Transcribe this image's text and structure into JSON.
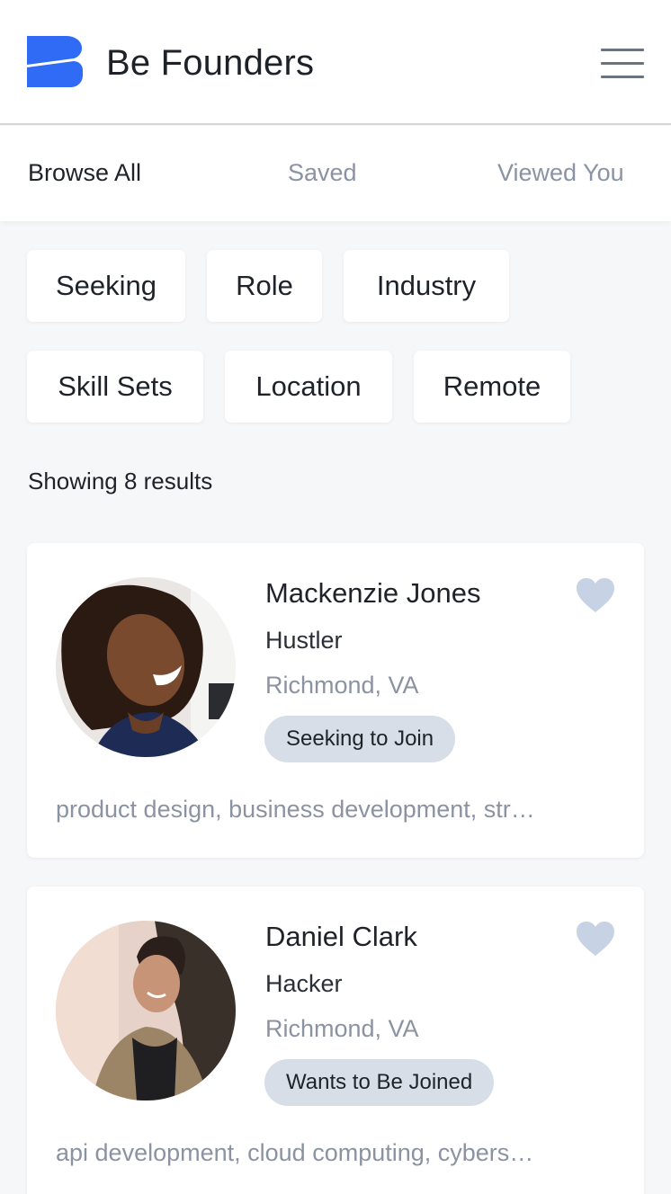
{
  "header": {
    "brand": "Be Founders",
    "logo_color": "#2f6bf5",
    "menu_icon": "hamburger-menu-icon"
  },
  "tabs": [
    {
      "label": "Browse All",
      "active": true
    },
    {
      "label": "Saved",
      "active": false
    },
    {
      "label": "Viewed You",
      "active": false
    }
  ],
  "filters": {
    "row1": [
      "Seeking",
      "Role",
      "Industry"
    ],
    "row2": [
      "Skill Sets",
      "Location",
      "Remote"
    ]
  },
  "results_text": "Showing 8 results",
  "profiles": [
    {
      "name": "Mackenzie Jones",
      "role": "Hustler",
      "location": "Richmond, VA",
      "status": "Seeking to Join",
      "skills": "product design, business development, str…"
    },
    {
      "name": "Daniel Clark",
      "role": "Hacker",
      "location": "Richmond, VA",
      "status": "Wants to Be Joined",
      "skills": "api development, cloud computing, cybers…"
    }
  ],
  "colors": {
    "accent": "#2f6bf5",
    "heart": "#c7d3e4",
    "badge_bg": "#d7dee8",
    "muted_text": "#8b93a3",
    "page_bg": "#f6f7f9"
  }
}
